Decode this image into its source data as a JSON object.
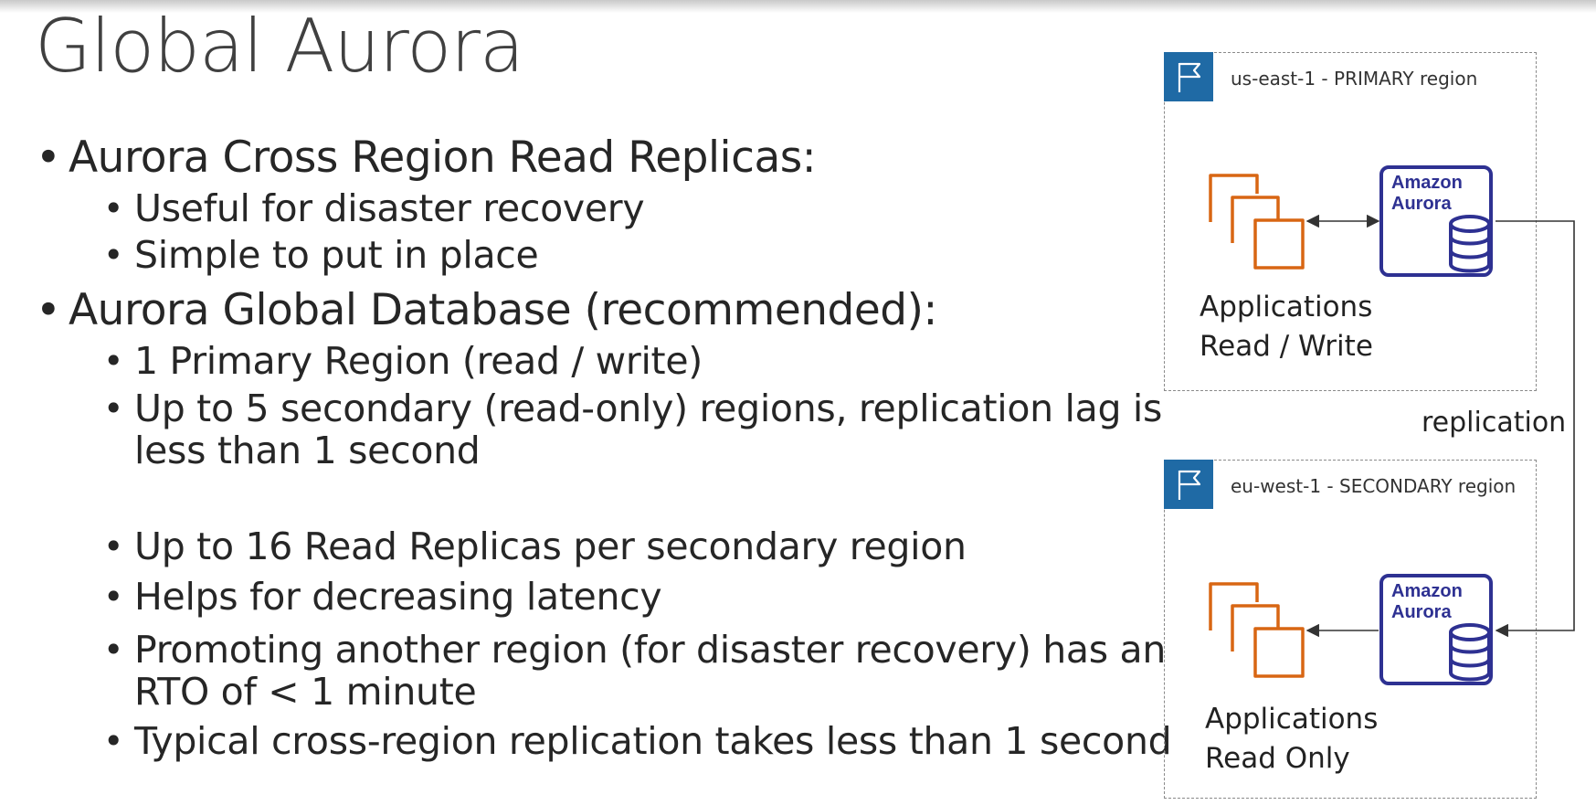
{
  "slide": {
    "title": "Global Aurora",
    "bullets": [
      {
        "text": "Aurora Cross Region Read Replicas:",
        "sub": [
          "Useful for disaster recovery",
          "Simple to put in place"
        ]
      },
      {
        "text": "Aurora Global Database (recommended):",
        "sub": [
          "1 Primary Region (read / write)",
          "Up to 5 secondary (read-only) regions, replication lag is",
          "less than 1 second",
          "Up to 16 Read Replicas per secondary region",
          "Helps for decreasing latency",
          "Promoting another region (for disaster recovery) has an",
          "RTO of < 1 minute",
          "Typical cross-region replication takes less than 1 second"
        ]
      }
    ]
  },
  "diagram": {
    "primary": {
      "region_label": "us-east-1 - PRIMARY region",
      "apps_line1": "Applications",
      "apps_line2": "Read / Write",
      "aurora_line1": "Amazon",
      "aurora_line2": "Aurora"
    },
    "secondary": {
      "region_label": "eu-west-1 - SECONDARY region",
      "apps_line1": "Applications",
      "apps_line2": "Read Only",
      "aurora_line1": "Amazon",
      "aurora_line2": "Aurora"
    },
    "replication_label": "replication",
    "colors": {
      "aurora": "#2e3192",
      "apps": "#d86613",
      "region_flag": "#1f6aa5"
    },
    "icons": [
      "region-flag-icon",
      "applications-icon",
      "aurora-database-icon"
    ]
  }
}
